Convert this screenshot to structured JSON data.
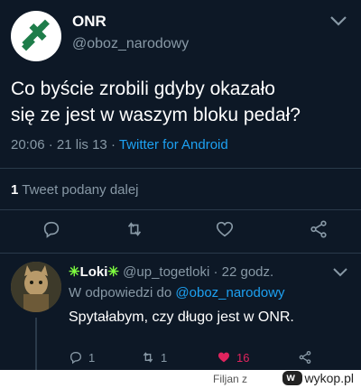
{
  "tweet": {
    "display_name": "ONR",
    "username": "@oboz_narodowy",
    "text_line1": "Co byście zrobili gdyby okazało",
    "text_line2": "się ze jest w waszym bloku pedał?",
    "time": "20:06",
    "date": "21 lis 13",
    "source": "Twitter for Android",
    "retweet_count": "1",
    "retweet_label": "Tweet podany dalej"
  },
  "reply": {
    "display_name": "Loki",
    "username": "@up_togetloki",
    "age": "22 godz.",
    "reply_to_prefix": "W odpowiedzi do",
    "reply_to_mention": "@oboz_narodowy",
    "text": "Spytałabym, czy długo jest w ONR.",
    "replies": "1",
    "retweets": "1",
    "likes": "16"
  },
  "footer": {
    "uploader": "Filjan z",
    "site": "wykop.pl"
  },
  "colors": {
    "background": "#0d1826",
    "accent": "#1da1f2",
    "like": "#e0245e",
    "muted": "#8899a6",
    "logo_green": "#1e7d4a"
  },
  "icons": [
    "onr-logo-icon",
    "chevron-down-icon",
    "reply-icon",
    "retweet-icon",
    "like-icon",
    "share-icon"
  ]
}
